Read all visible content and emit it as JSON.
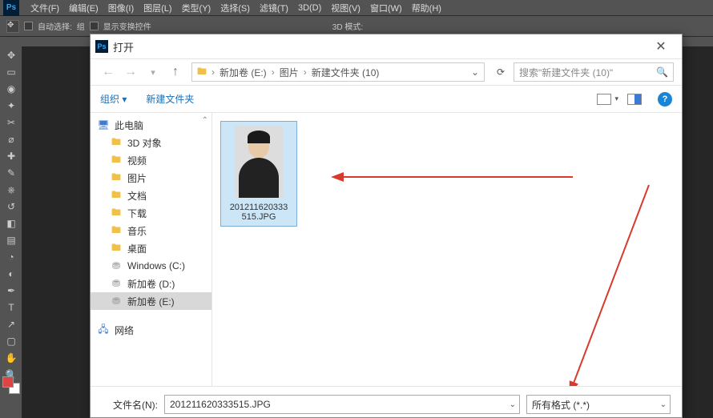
{
  "menubar": {
    "items": [
      "文件(F)",
      "编辑(E)",
      "图像(I)",
      "图层(L)",
      "类型(Y)",
      "选择(S)",
      "滤镜(T)",
      "3D(D)",
      "视图(V)",
      "窗口(W)",
      "帮助(H)"
    ]
  },
  "optionsbar": {
    "auto_select": "自动选择:",
    "group": "组",
    "show_transform": "显示变换控件",
    "threeD": "3D 模式:"
  },
  "dialog": {
    "title": "打开",
    "breadcrumb": {
      "sep": "›",
      "parts": [
        "新加卷 (E:)",
        "图片",
        "新建文件夹 (10)"
      ]
    },
    "search_placeholder": "搜索\"新建文件夹 (10)\"",
    "organize": "组织 ▾",
    "new_folder": "新建文件夹",
    "tree": [
      {
        "icon": "pc",
        "label": "此电脑",
        "root": true
      },
      {
        "icon": "fld",
        "label": "3D 对象"
      },
      {
        "icon": "fld",
        "label": "视频"
      },
      {
        "icon": "fld",
        "label": "图片"
      },
      {
        "icon": "fld",
        "label": "文档"
      },
      {
        "icon": "fld",
        "label": "下载"
      },
      {
        "icon": "fld",
        "label": "音乐"
      },
      {
        "icon": "fld",
        "label": "桌面"
      },
      {
        "icon": "drv",
        "label": "Windows (C:)"
      },
      {
        "icon": "drv",
        "label": "新加卷 (D:)"
      },
      {
        "icon": "drv",
        "label": "新加卷 (E:)",
        "sel": true
      },
      {
        "icon": "pc",
        "label": "网络",
        "root": true,
        "net": true
      }
    ],
    "file": {
      "name_l1": "201211620333",
      "name_l2": "515.JPG"
    },
    "filename_label": "文件名(N):",
    "filename_value": "201211620333515.JPG",
    "filter": "所有格式 (*.*)"
  }
}
